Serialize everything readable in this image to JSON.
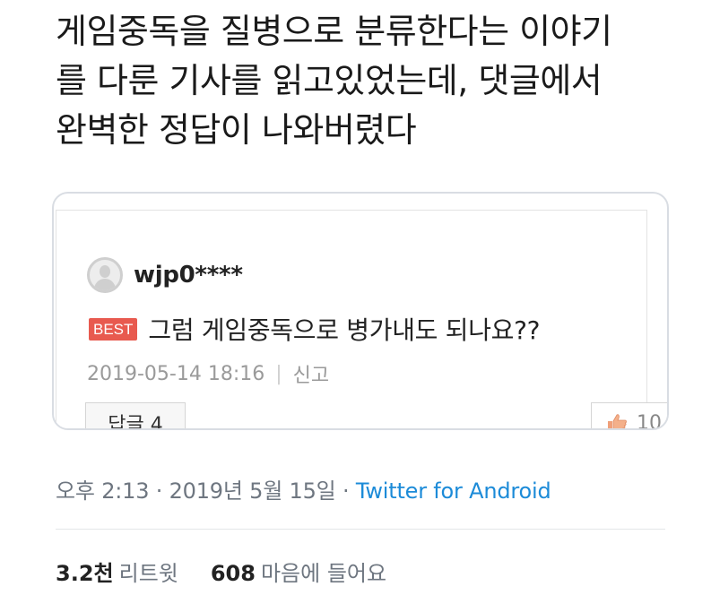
{
  "tweet": {
    "lines": [
      "게임중독을 질병으로 분류한다는 이야기",
      "를 다룬 기사를 읽고있었는데, 댓글에서",
      "완벽한 정답이 나와버렸다"
    ]
  },
  "comment_card": {
    "username": "wjp0****",
    "badge": "BEST",
    "comment": "그럼 게임중독으로 병가내도 되나요??",
    "datetime": "2019-05-14 18:16",
    "separator": "|",
    "report_label": "신고",
    "reply_label": "답글 4",
    "like_count": "10",
    "badge_color": "#e85a4f"
  },
  "tweet_meta": {
    "time_date": "오후 2:13 · 2019년 5월 15일 · ",
    "source": "Twitter for Android",
    "source_color": "#1c8bd8"
  },
  "stats": {
    "retweets_count": "3.2천",
    "retweets_label": "리트윗",
    "likes_count": "608",
    "likes_label": "마음에 들어요"
  }
}
